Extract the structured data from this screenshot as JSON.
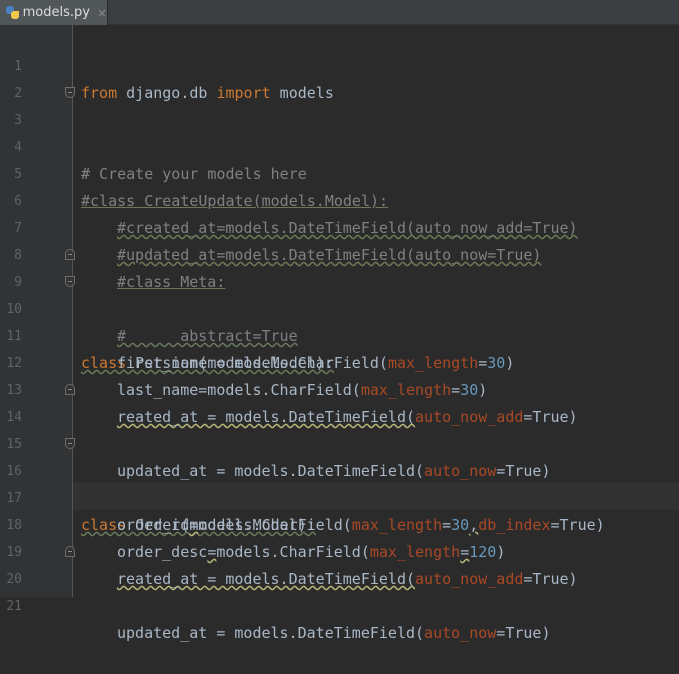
{
  "tab": {
    "filename": "models.py",
    "close": "×"
  },
  "gutter": {
    "line_numbers": [
      "1",
      "2",
      "3",
      "4",
      "5",
      "6",
      "7",
      "8",
      "9",
      "10",
      "11",
      "12",
      "13",
      "14",
      "15",
      "16",
      "17",
      "18",
      "19",
      "20",
      "21"
    ]
  },
  "code": {
    "l1": {
      "from": "from",
      "module": " django.db ",
      "import": "import",
      "name": " models"
    },
    "l3": {
      "text": "# Create your models here"
    },
    "l4": {
      "text": "#"
    },
    "l5": {
      "text": "#class CreateUpdate(models.Model):"
    },
    "l6": {
      "text": "#created_at=models.DateTimeField(auto_now_add=True)"
    },
    "l7": {
      "text": "#updated_at=models.DateTimeField(auto_now=True)"
    },
    "l8": {
      "text": "#class Meta:"
    },
    "l9": {
      "text": "#      abstract=True"
    },
    "l10": {
      "kw": "class",
      "text": " Persion(models.Model):"
    },
    "l11": {
      "a": "first_name = models.CharField(",
      "p": "max_length",
      "b": "=",
      "n": "30",
      "c": ")"
    },
    "l12": {
      "a": "last_name=models.CharField(",
      "p": "max_length",
      "b": "=",
      "n": "30",
      "c": ")"
    },
    "l13": {
      "a": "reated_at = models.DateTimeField(",
      "p": "auto_now_add",
      "b": "=True)"
    },
    "l14": {
      "a": "updated_at = models.DateTimeField(",
      "p": "auto_now",
      "b": "=True)"
    },
    "l16": {
      "kw": "class",
      "text": " Order(models.Model):"
    },
    "l17": {
      "a1": "order_id",
      "a2": "=",
      "a3": "models.CharField(",
      "p": "max_length",
      "b": "=",
      "n": "30",
      "comma": ",",
      "p2": "db_index",
      "c": "=True)"
    },
    "l18": {
      "a1": "order_desc",
      "a2": "=",
      "a3": "models.CharField(",
      "p": "max_length",
      "b": "=",
      "n": "120",
      "c": ")"
    },
    "l19": {
      "a": "reated_at = models.DateTimeField(",
      "p": "auto_now_add",
      "b": "=True)"
    },
    "l20": {
      "a": "updated_at = models.DateTimeField(",
      "p": "auto_now",
      "b": "=True)"
    }
  },
  "colors": {
    "background": "#2b2b2b",
    "gutter": "#313335",
    "keyword": "#cc7832",
    "comment": "#808080",
    "param": "#aa4926",
    "number": "#6897bb",
    "text": "#a9b7c6"
  },
  "icons": {
    "file": "python-file-icon",
    "fold": "fold-marker-icon"
  }
}
